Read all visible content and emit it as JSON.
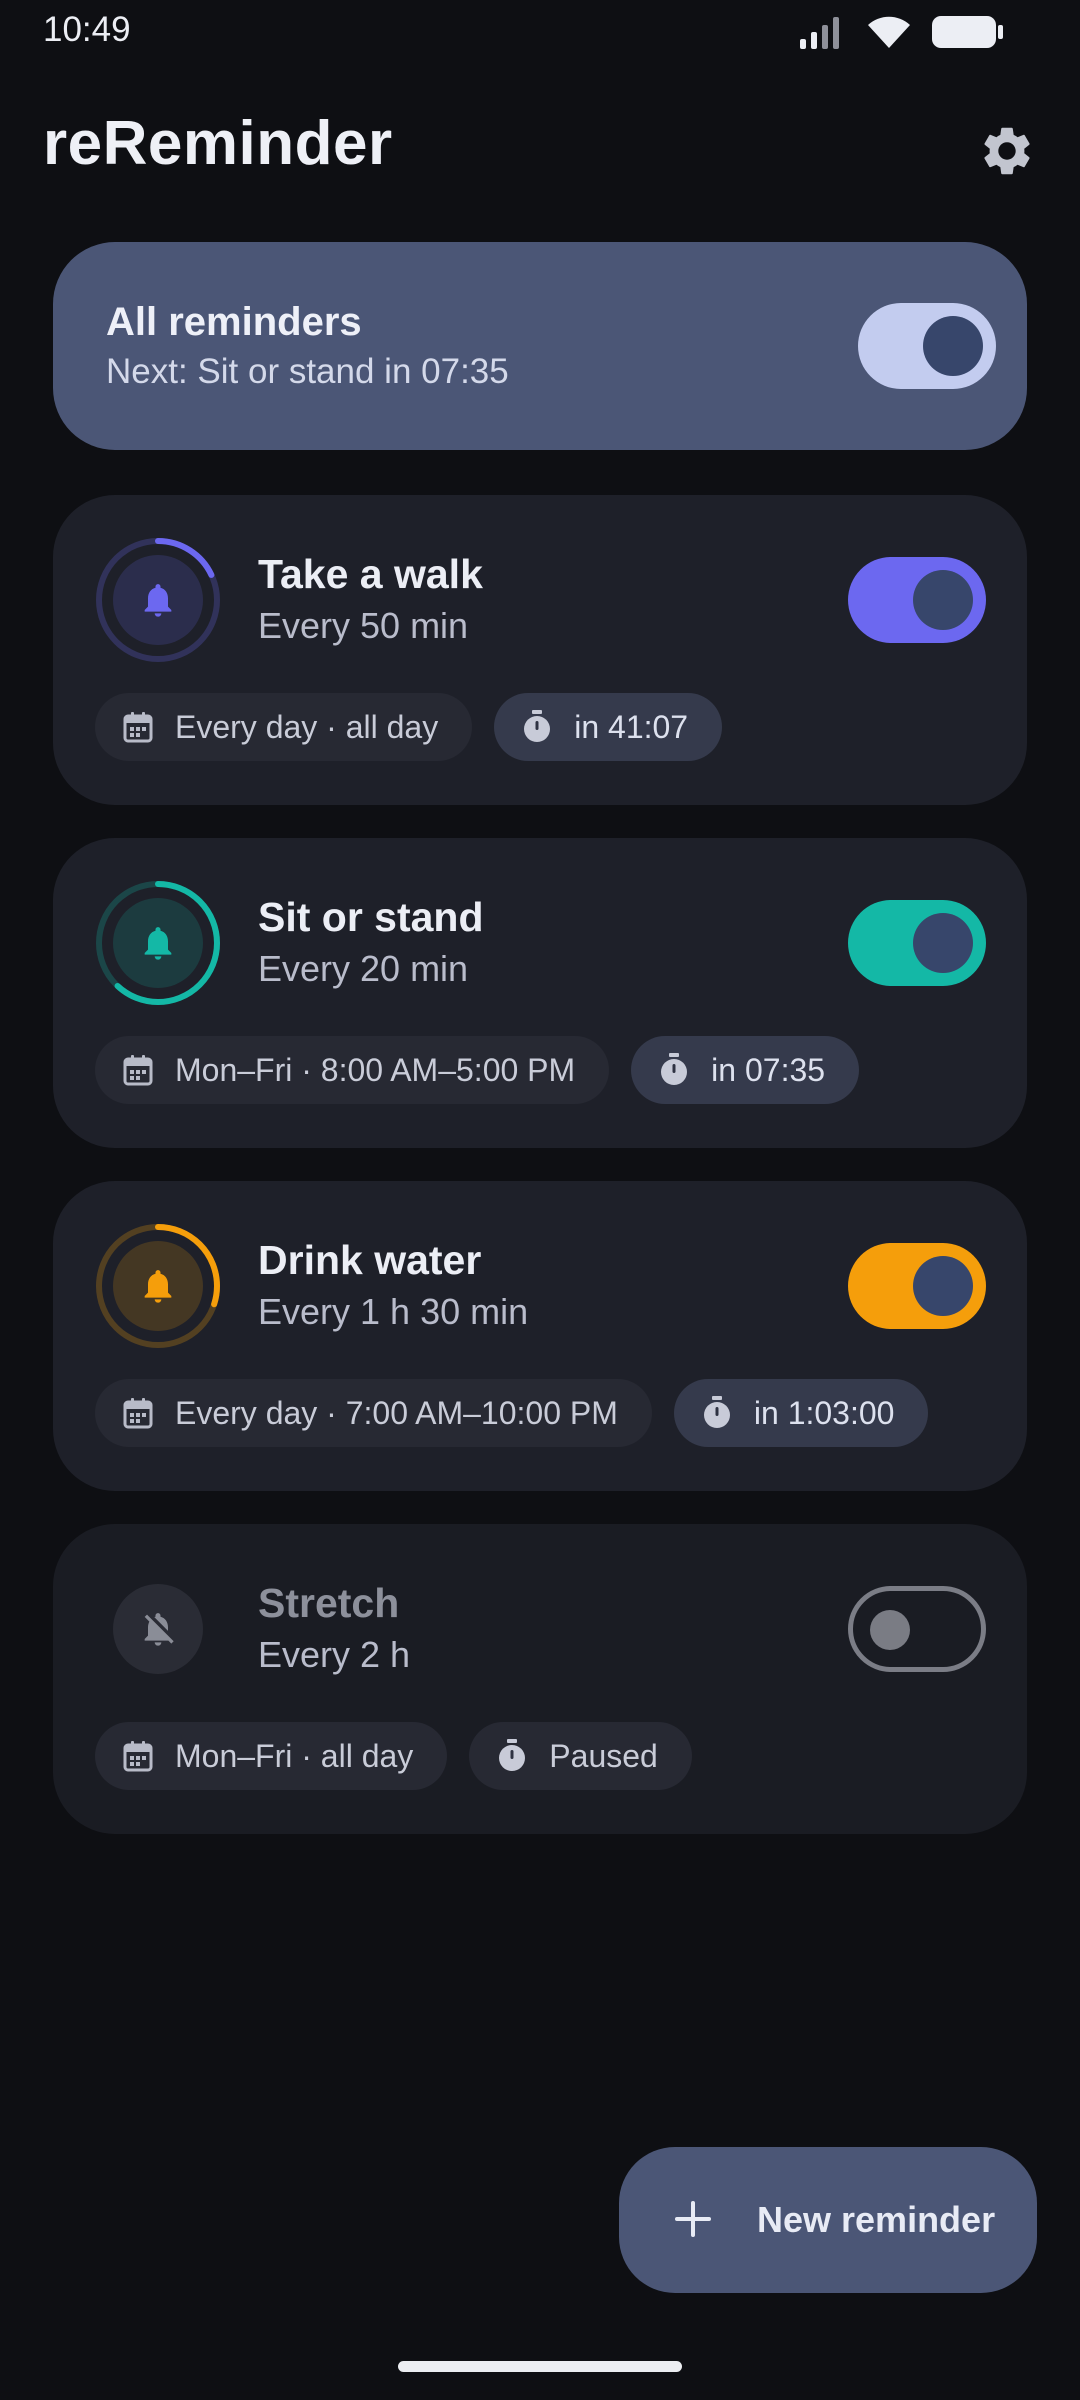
{
  "status_bar": {
    "time": "10:49"
  },
  "app": {
    "title": "reReminder"
  },
  "master": {
    "title": "All reminders",
    "subtitle": "Next: Sit or stand in 07:35",
    "enabled": true,
    "track_color": "#c3ccef"
  },
  "reminders": [
    {
      "title": "Take a walk",
      "interval": "Every 50 min",
      "schedule": "Every day · all day",
      "countdown": "in 41:07",
      "enabled": true,
      "accent": "#6c68f0",
      "progress": 0.18
    },
    {
      "title": "Sit or stand",
      "interval": "Every 20 min",
      "schedule": "Mon–Fri · 8:00 AM–5:00 PM",
      "countdown": "in 07:35",
      "enabled": true,
      "accent": "#14b8a6",
      "progress": 0.62
    },
    {
      "title": "Drink water",
      "interval": "Every 1 h 30 min",
      "schedule": "Every day · 7:00 AM–10:00 PM",
      "countdown": "in 1:03:00",
      "enabled": true,
      "accent": "#f59e0b",
      "progress": 0.3
    },
    {
      "title": "Stretch",
      "interval": "Every 2 h",
      "schedule": "Mon–Fri · all day",
      "countdown": "Paused",
      "enabled": false,
      "accent": "#7a7c84",
      "progress": 0
    }
  ],
  "fab": {
    "label": "New reminder"
  },
  "icons": {
    "settings": "gear-icon",
    "bell": "bell-icon",
    "bell_off": "bell-off-icon",
    "calendar": "calendar-icon",
    "timer": "stopwatch-icon",
    "add": "plus-icon"
  }
}
